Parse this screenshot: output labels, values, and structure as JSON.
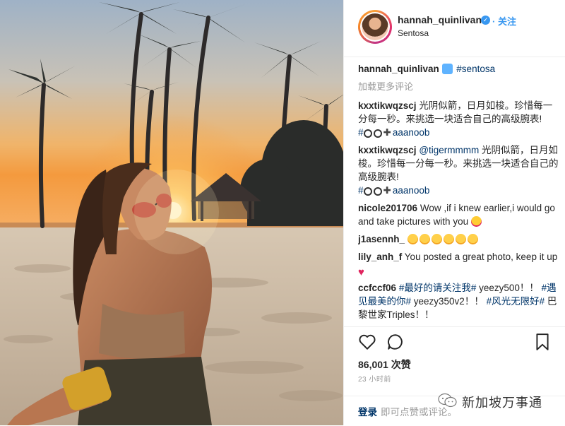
{
  "post": {
    "username": "hannah_quinlivan",
    "verified_mark": "✓",
    "follow_label": "· 关注",
    "location": "Sentosa"
  },
  "caption": {
    "author": "hannah_quinlivan",
    "emoji": "beach-umbrella-emoji",
    "tag": "#sentosa"
  },
  "load_more": "加载更多评论",
  "comments": [
    {
      "author": "kxxtikwqzscj",
      "text": "光阴似箭，日月如梭。珍惜每一分每一秒。来挑选一块适合自己的高级腕表!",
      "tail_tag": "#",
      "tail_user": "aaanoob"
    },
    {
      "author": "kxxtikwqzscj",
      "mention": "@tigermmmm",
      "text": "光阴似箭，日月如梭。珍惜每一分每一秒。来挑选一块适合自己的高级腕表!",
      "tail_tag": "#",
      "tail_user": "aaanoob"
    },
    {
      "author": "nicole201706",
      "text": "Wow ,if i knew earlier,i would go and take pictures with you"
    },
    {
      "author": "j1asennh_",
      "text": ""
    },
    {
      "author": "lily_anh_f",
      "text": "You posted a great photo, keep it up"
    },
    {
      "author": "ccfccf06",
      "t1": "#最好的请关注我#",
      "t2": " yeezy500！！",
      "t3": "#遇见最美的你#",
      "t4": " yeezy350v2！！",
      "t5": "#风光无限好#",
      "t6": " 巴黎世家Triples！！"
    }
  ],
  "likes": "86,001 次赞",
  "time": "23 小时前",
  "footer": {
    "login": "登录",
    "hint": "即可点赞或评论。"
  },
  "watermark": "新加坡万事通",
  "colors": {
    "link": "#003569",
    "accent": "#3897f0",
    "heart": "#e0245e"
  }
}
